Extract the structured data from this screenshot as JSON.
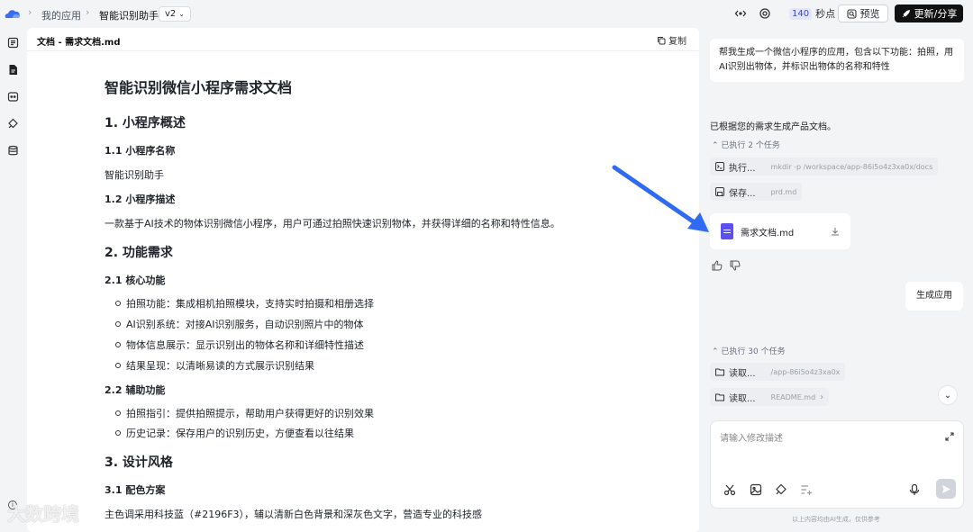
{
  "topbar": {
    "breadcrumb": [
      "我的应用",
      "智能识别助手"
    ],
    "version": "v2",
    "credits_value": "140",
    "credits_unit": "秒点",
    "preview_label": "预览",
    "share_label": "更新/分享"
  },
  "document": {
    "tab_title": "文档 - 需求文档.md",
    "copy_label": "复制",
    "title": "智能识别微信小程序需求文档",
    "sec1": "1. 小程序概述",
    "sec1_1": "1.1 小程序名称",
    "app_name": "智能识别助手",
    "sec1_2": "1.2 小程序描述",
    "description": "一款基于AI技术的物体识别微信小程序，用户可通过拍照快速识别物体，并获得详细的名称和特性信息。",
    "sec2": "2. 功能需求",
    "sec2_1": "2.1 核心功能",
    "core_features": [
      "拍照功能：集成相机拍照模块，支持实时拍摄和相册选择",
      "AI识别系统：对接AI识别服务，自动识别照片中的物体",
      "物体信息展示：显示识别出的物体名称和详细特性描述",
      "结果呈现：以清晰易读的方式展示识别结果"
    ],
    "sec2_2": "2.2 辅助功能",
    "aux_features": [
      "拍照指引：提供拍照提示，帮助用户获得更好的识别效果",
      "历史记录：保存用户的识别历史，方便查看以往结果"
    ],
    "sec3": "3. 设计风格",
    "sec3_1": "3.1 配色方案",
    "color_scheme": "主色调采用科技蓝（#2196F3），辅以清新白色背景和深灰色文字，营造专业的科技感"
  },
  "chat": {
    "user_message": "帮我生成一个微信小程序的应用，包含以下功能：拍照，用AI识别出物体，并标识出物体的名称和特性",
    "bot_reply": "已根据您的需求生成产品文档。",
    "tasks_group1_label": "已执行 2 个任务",
    "tasks_group1": [
      {
        "action": "执行...",
        "detail": "mkdir -p /workspace/app-86i5o4z3xa0x/docs"
      },
      {
        "action": "保存...",
        "detail": "prd.md"
      }
    ],
    "file_name": "需求文档.md",
    "user_message2": "生成应用",
    "tasks_group2_label": "已执行 30 个任务",
    "tasks_group2": [
      {
        "action": "读取...",
        "detail": "/app-86i5o4z3xa0x"
      },
      {
        "action": "读取...",
        "detail": "README.md"
      }
    ],
    "input_placeholder": "请输入修改描述",
    "disclaimer": "以上内容均由AI生成，仅供参考"
  },
  "watermark": "大数跨境",
  "colors": {
    "accent": "#2f6bf2",
    "brand_purple": "#5b4ff0",
    "share_bg": "#111111"
  }
}
